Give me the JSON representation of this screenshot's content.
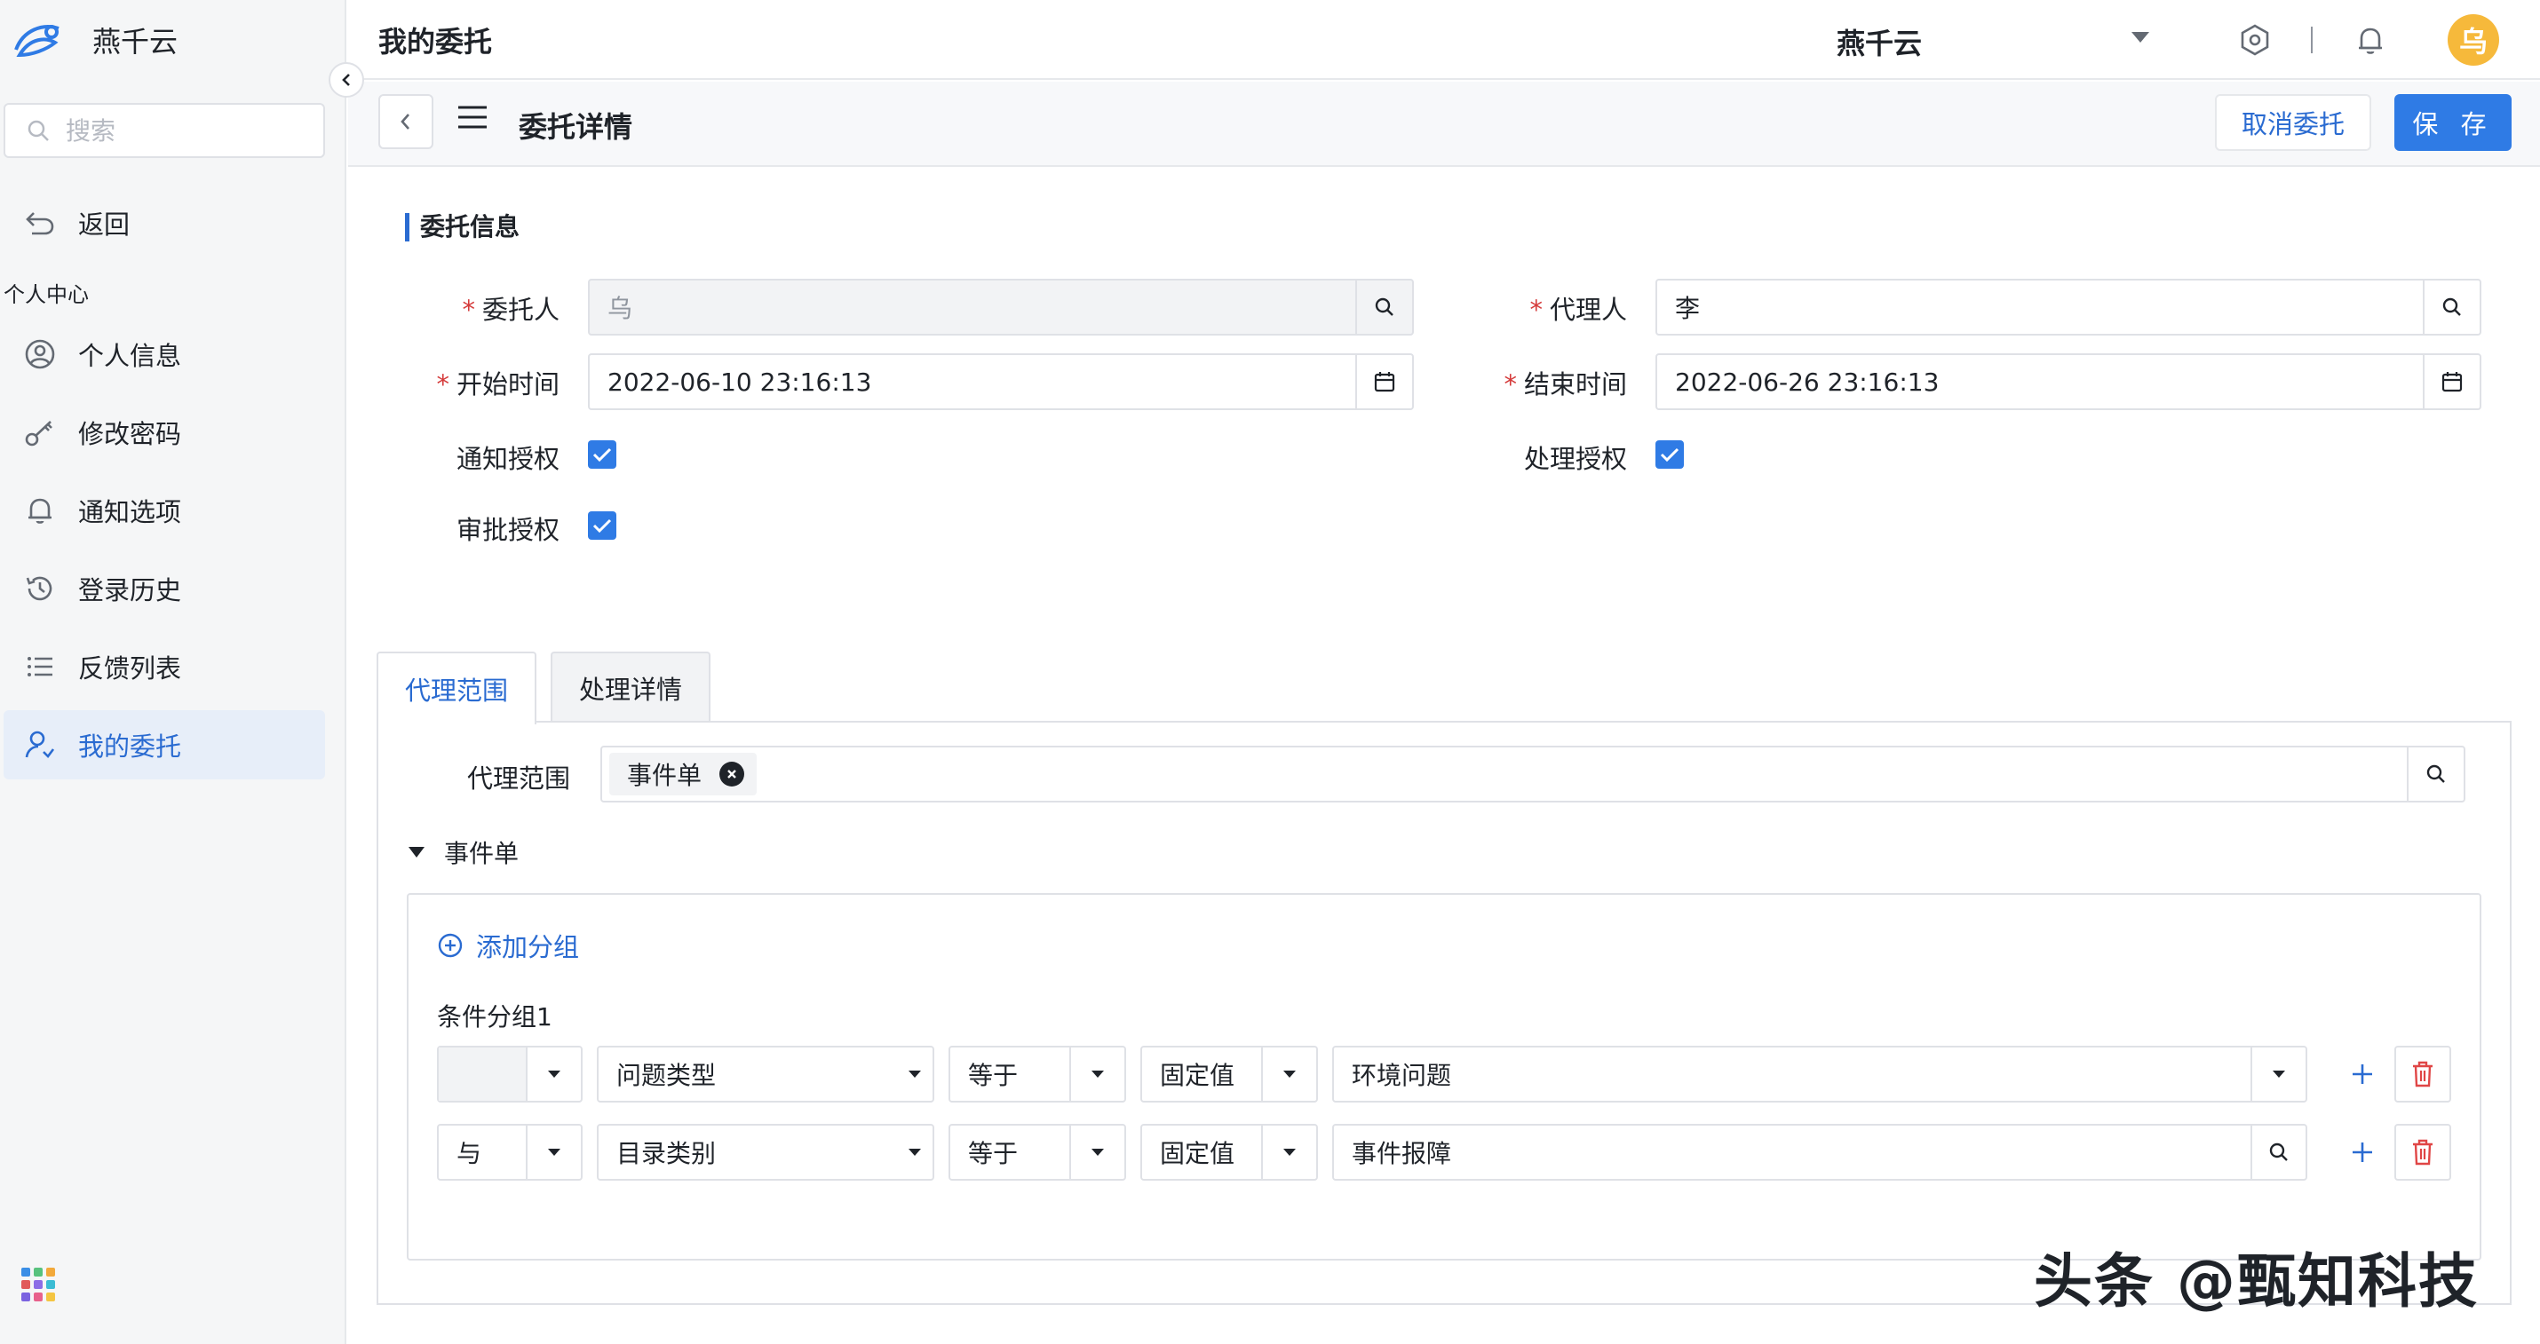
{
  "app": {
    "name": "燕千云"
  },
  "sidebar": {
    "search_placeholder": "搜索",
    "back_label": "返回",
    "section_label": "个人中心",
    "items": [
      {
        "label": "个人信息",
        "icon": "user-circle-icon"
      },
      {
        "label": "修改密码",
        "icon": "key-icon"
      },
      {
        "label": "通知选项",
        "icon": "bell-icon"
      },
      {
        "label": "登录历史",
        "icon": "history-icon"
      },
      {
        "label": "反馈列表",
        "icon": "list-icon"
      },
      {
        "label": "我的委托",
        "icon": "user-delegate-icon",
        "active": true
      }
    ]
  },
  "header": {
    "title": "我的委托",
    "tenant": "燕千云",
    "avatar_text": "乌"
  },
  "subheader": {
    "title": "委托详情",
    "cancel_label": "取消委托",
    "save_label": "保 存"
  },
  "form": {
    "section_title": "委托信息",
    "delegator": {
      "label": "委托人",
      "value": "乌",
      "required": true
    },
    "agent": {
      "label": "代理人",
      "value": "李",
      "required": true
    },
    "start_time": {
      "label": "开始时间",
      "value": "2022-06-10 23:16:13",
      "required": true
    },
    "end_time": {
      "label": "结束时间",
      "value": "2022-06-26 23:16:13",
      "required": true
    },
    "notify_auth": {
      "label": "通知授权",
      "checked": true
    },
    "process_auth": {
      "label": "处理授权",
      "checked": true
    },
    "approve_auth": {
      "label": "审批授权",
      "checked": true
    }
  },
  "tabs": [
    {
      "label": "代理范围",
      "active": true
    },
    {
      "label": "处理详情",
      "active": false
    }
  ],
  "scope": {
    "label": "代理范围",
    "tags": [
      "事件单"
    ],
    "collapse_title": "事件单",
    "add_group_label": "添加分组",
    "group_name": "条件分组1",
    "rows": [
      {
        "logic": "",
        "field": "问题类型",
        "operator": "等于",
        "value_type": "固定值",
        "value": "环境问题"
      },
      {
        "logic": "与",
        "field": "目录类别",
        "operator": "等于",
        "value_type": "固定值",
        "value": "事件报障"
      }
    ]
  },
  "watermark": "头条 @甄知科技",
  "colors": {
    "primary": "#2f7be5",
    "required": "#d53b3b",
    "danger": "#e04646",
    "avatar": "#f6b93b"
  }
}
